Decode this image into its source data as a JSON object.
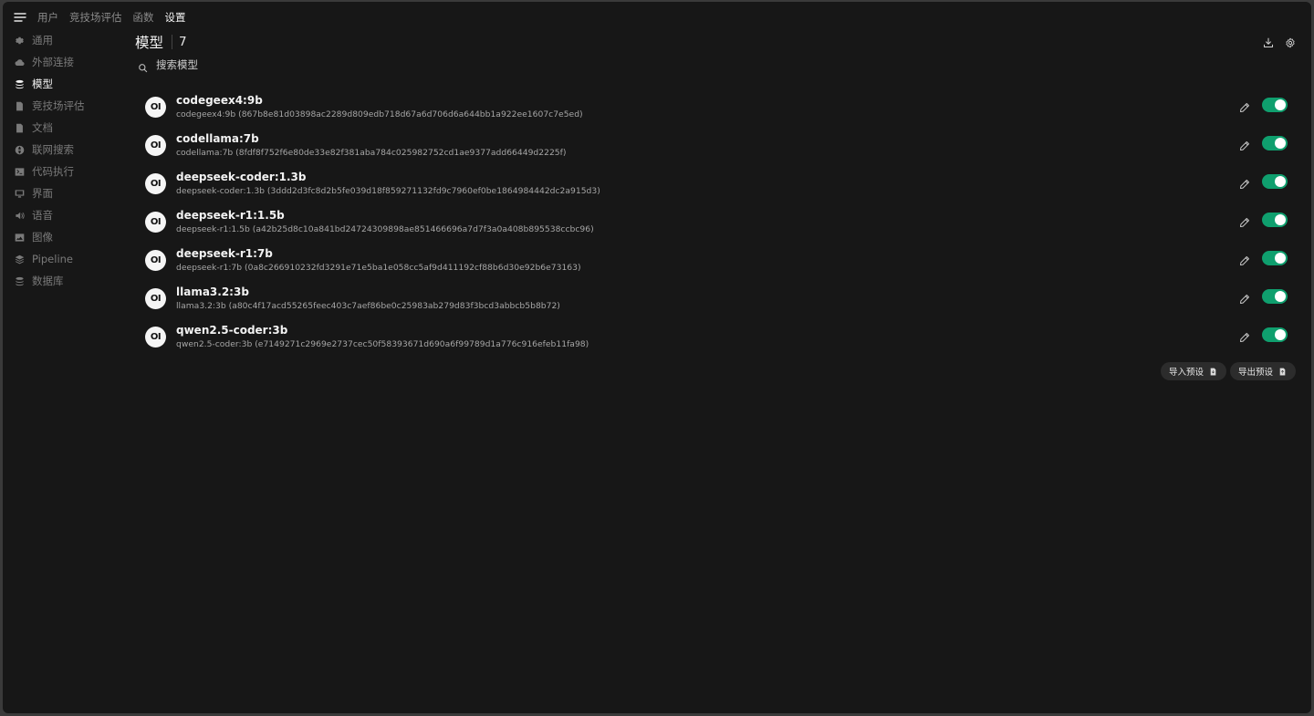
{
  "topnav": {
    "tabs": [
      {
        "label": "用户",
        "active": false
      },
      {
        "label": "竞技场评估",
        "active": false
      },
      {
        "label": "函数",
        "active": false
      },
      {
        "label": "设置",
        "active": true
      }
    ]
  },
  "sidebar": {
    "items": [
      {
        "label": "通用",
        "icon": "gear-icon"
      },
      {
        "label": "外部连接",
        "icon": "cloud-icon"
      },
      {
        "label": "模型",
        "icon": "stack-icon",
        "active": true
      },
      {
        "label": "竞技场评估",
        "icon": "document-icon"
      },
      {
        "label": "文档",
        "icon": "document-icon"
      },
      {
        "label": "联网搜索",
        "icon": "globe-icon"
      },
      {
        "label": "代码执行",
        "icon": "terminal-icon"
      },
      {
        "label": "界面",
        "icon": "monitor-icon"
      },
      {
        "label": "语音",
        "icon": "speaker-icon"
      },
      {
        "label": "图像",
        "icon": "image-icon"
      },
      {
        "label": "Pipeline",
        "icon": "layers-icon"
      },
      {
        "label": "数据库",
        "icon": "database-icon"
      }
    ]
  },
  "main": {
    "title": "模型",
    "count": "7",
    "search": {
      "placeholder": "搜索模型"
    },
    "models": [
      {
        "avatar": "OI",
        "name": "codegeex4:9b",
        "desc": "codegeex4:9b (867b8e81d03898ac2289d809edb718d67a6d706d6a644bb1a922ee1607c7e5ed)",
        "enabled": true
      },
      {
        "avatar": "OI",
        "name": "codellama:7b",
        "desc": "codellama:7b (8fdf8f752f6e80de33e82f381aba784c025982752cd1ae9377add66449d2225f)",
        "enabled": true
      },
      {
        "avatar": "OI",
        "name": "deepseek-coder:1.3b",
        "desc": "deepseek-coder:1.3b (3ddd2d3fc8d2b5fe039d18f859271132fd9c7960ef0be1864984442dc2a915d3)",
        "enabled": true
      },
      {
        "avatar": "OI",
        "name": "deepseek-r1:1.5b",
        "desc": "deepseek-r1:1.5b (a42b25d8c10a841bd24724309898ae851466696a7d7f3a0a408b895538ccbc96)",
        "enabled": true
      },
      {
        "avatar": "OI",
        "name": "deepseek-r1:7b",
        "desc": "deepseek-r1:7b (0a8c266910232fd3291e71e5ba1e058cc5af9d411192cf88b6d30e92b6e73163)",
        "enabled": true
      },
      {
        "avatar": "OI",
        "name": "llama3.2:3b",
        "desc": "llama3.2:3b (a80c4f17acd55265feec403c7aef86be0c25983ab279d83f3bcd3abbcb5b8b72)",
        "enabled": true
      },
      {
        "avatar": "OI",
        "name": "qwen2.5-coder:3b",
        "desc": "qwen2.5-coder:3b (e7149271c2969e2737cec50f58393671d690a6f99789d1a776c916efeb11fa98)",
        "enabled": true
      }
    ],
    "import_label": "导入预设",
    "export_label": "导出预设"
  },
  "colors": {
    "background": "#171717",
    "toggle_on": "#0f9f6e",
    "text": "#e5e5e5",
    "muted": "#7a7a7a"
  }
}
